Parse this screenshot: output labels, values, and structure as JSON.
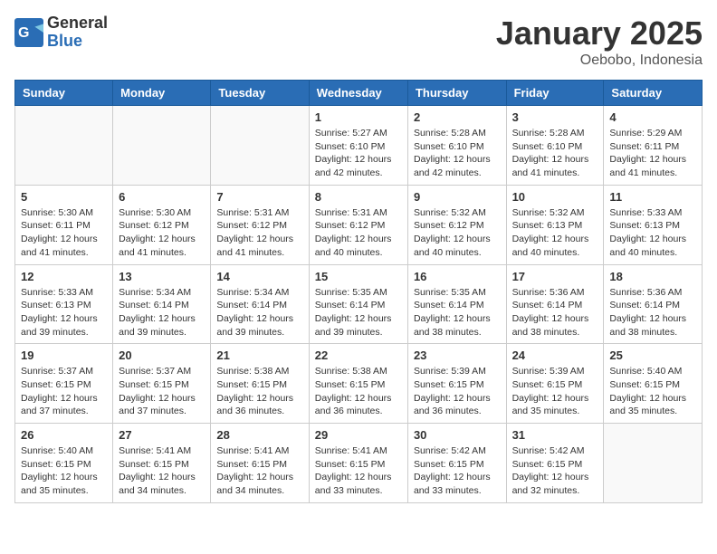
{
  "logo": {
    "general": "General",
    "blue": "Blue"
  },
  "header": {
    "month": "January 2025",
    "location": "Oebobo, Indonesia"
  },
  "weekdays": [
    "Sunday",
    "Monday",
    "Tuesday",
    "Wednesday",
    "Thursday",
    "Friday",
    "Saturday"
  ],
  "weeks": [
    [
      {
        "day": "",
        "info": ""
      },
      {
        "day": "",
        "info": ""
      },
      {
        "day": "",
        "info": ""
      },
      {
        "day": "1",
        "info": "Sunrise: 5:27 AM\nSunset: 6:10 PM\nDaylight: 12 hours\nand 42 minutes."
      },
      {
        "day": "2",
        "info": "Sunrise: 5:28 AM\nSunset: 6:10 PM\nDaylight: 12 hours\nand 42 minutes."
      },
      {
        "day": "3",
        "info": "Sunrise: 5:28 AM\nSunset: 6:10 PM\nDaylight: 12 hours\nand 41 minutes."
      },
      {
        "day": "4",
        "info": "Sunrise: 5:29 AM\nSunset: 6:11 PM\nDaylight: 12 hours\nand 41 minutes."
      }
    ],
    [
      {
        "day": "5",
        "info": "Sunrise: 5:30 AM\nSunset: 6:11 PM\nDaylight: 12 hours\nand 41 minutes."
      },
      {
        "day": "6",
        "info": "Sunrise: 5:30 AM\nSunset: 6:12 PM\nDaylight: 12 hours\nand 41 minutes."
      },
      {
        "day": "7",
        "info": "Sunrise: 5:31 AM\nSunset: 6:12 PM\nDaylight: 12 hours\nand 41 minutes."
      },
      {
        "day": "8",
        "info": "Sunrise: 5:31 AM\nSunset: 6:12 PM\nDaylight: 12 hours\nand 40 minutes."
      },
      {
        "day": "9",
        "info": "Sunrise: 5:32 AM\nSunset: 6:12 PM\nDaylight: 12 hours\nand 40 minutes."
      },
      {
        "day": "10",
        "info": "Sunrise: 5:32 AM\nSunset: 6:13 PM\nDaylight: 12 hours\nand 40 minutes."
      },
      {
        "day": "11",
        "info": "Sunrise: 5:33 AM\nSunset: 6:13 PM\nDaylight: 12 hours\nand 40 minutes."
      }
    ],
    [
      {
        "day": "12",
        "info": "Sunrise: 5:33 AM\nSunset: 6:13 PM\nDaylight: 12 hours\nand 39 minutes."
      },
      {
        "day": "13",
        "info": "Sunrise: 5:34 AM\nSunset: 6:14 PM\nDaylight: 12 hours\nand 39 minutes."
      },
      {
        "day": "14",
        "info": "Sunrise: 5:34 AM\nSunset: 6:14 PM\nDaylight: 12 hours\nand 39 minutes."
      },
      {
        "day": "15",
        "info": "Sunrise: 5:35 AM\nSunset: 6:14 PM\nDaylight: 12 hours\nand 39 minutes."
      },
      {
        "day": "16",
        "info": "Sunrise: 5:35 AM\nSunset: 6:14 PM\nDaylight: 12 hours\nand 38 minutes."
      },
      {
        "day": "17",
        "info": "Sunrise: 5:36 AM\nSunset: 6:14 PM\nDaylight: 12 hours\nand 38 minutes."
      },
      {
        "day": "18",
        "info": "Sunrise: 5:36 AM\nSunset: 6:14 PM\nDaylight: 12 hours\nand 38 minutes."
      }
    ],
    [
      {
        "day": "19",
        "info": "Sunrise: 5:37 AM\nSunset: 6:15 PM\nDaylight: 12 hours\nand 37 minutes."
      },
      {
        "day": "20",
        "info": "Sunrise: 5:37 AM\nSunset: 6:15 PM\nDaylight: 12 hours\nand 37 minutes."
      },
      {
        "day": "21",
        "info": "Sunrise: 5:38 AM\nSunset: 6:15 PM\nDaylight: 12 hours\nand 36 minutes."
      },
      {
        "day": "22",
        "info": "Sunrise: 5:38 AM\nSunset: 6:15 PM\nDaylight: 12 hours\nand 36 minutes."
      },
      {
        "day": "23",
        "info": "Sunrise: 5:39 AM\nSunset: 6:15 PM\nDaylight: 12 hours\nand 36 minutes."
      },
      {
        "day": "24",
        "info": "Sunrise: 5:39 AM\nSunset: 6:15 PM\nDaylight: 12 hours\nand 35 minutes."
      },
      {
        "day": "25",
        "info": "Sunrise: 5:40 AM\nSunset: 6:15 PM\nDaylight: 12 hours\nand 35 minutes."
      }
    ],
    [
      {
        "day": "26",
        "info": "Sunrise: 5:40 AM\nSunset: 6:15 PM\nDaylight: 12 hours\nand 35 minutes."
      },
      {
        "day": "27",
        "info": "Sunrise: 5:41 AM\nSunset: 6:15 PM\nDaylight: 12 hours\nand 34 minutes."
      },
      {
        "day": "28",
        "info": "Sunrise: 5:41 AM\nSunset: 6:15 PM\nDaylight: 12 hours\nand 34 minutes."
      },
      {
        "day": "29",
        "info": "Sunrise: 5:41 AM\nSunset: 6:15 PM\nDaylight: 12 hours\nand 33 minutes."
      },
      {
        "day": "30",
        "info": "Sunrise: 5:42 AM\nSunset: 6:15 PM\nDaylight: 12 hours\nand 33 minutes."
      },
      {
        "day": "31",
        "info": "Sunrise: 5:42 AM\nSunset: 6:15 PM\nDaylight: 12 hours\nand 32 minutes."
      },
      {
        "day": "",
        "info": ""
      }
    ]
  ]
}
